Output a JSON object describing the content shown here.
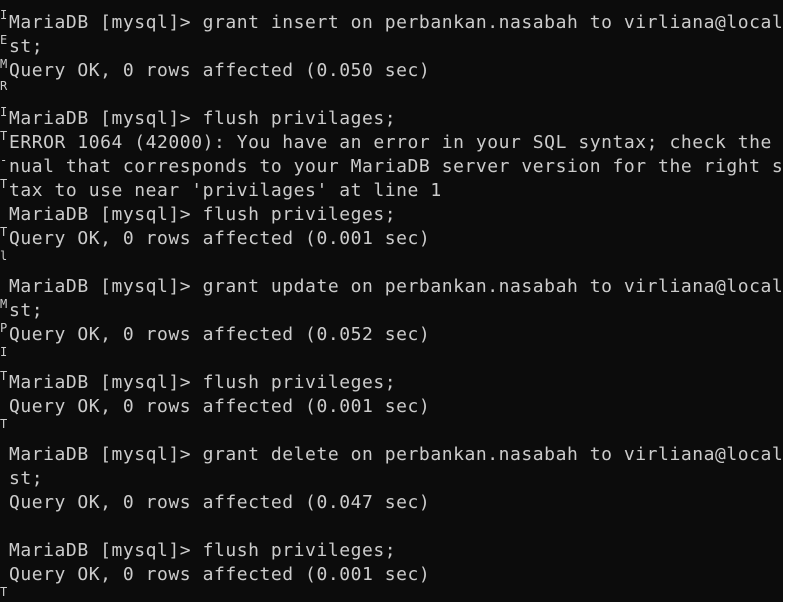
{
  "terminal": {
    "lines": [
      "MariaDB [mysql]> grant insert on perbankan.nasabah to virliana@localho",
      "st;",
      "Query OK, 0 rows affected (0.050 sec)",
      "",
      "MariaDB [mysql]> flush privilages;",
      "ERROR 1064 (42000): You have an error in your SQL syntax; check the ma",
      "nual that corresponds to your MariaDB server version for the right syn",
      "tax to use near 'privilages' at line 1",
      "MariaDB [mysql]> flush privileges;",
      "Query OK, 0 rows affected (0.001 sec)",
      "",
      "MariaDB [mysql]> grant update on perbankan.nasabah to virliana@localho",
      "st;",
      "Query OK, 0 rows affected (0.052 sec)",
      "",
      "MariaDB [mysql]> flush privileges;",
      "Query OK, 0 rows affected (0.001 sec)",
      "",
      "MariaDB [mysql]> grant delete on perbankan.nasabah to virliana@localho",
      "st;",
      "Query OK, 0 rows affected (0.047 sec)",
      "",
      "MariaDB [mysql]> flush privileges;",
      "Query OK, 0 rows affected (0.001 sec)"
    ],
    "gutter_fragments": [
      "I",
      "E",
      "M",
      "R",
      "I",
      "T",
      "-",
      "T",
      "T",
      "l",
      "M",
      "P",
      "I",
      "T",
      "T",
      "T"
    ]
  }
}
